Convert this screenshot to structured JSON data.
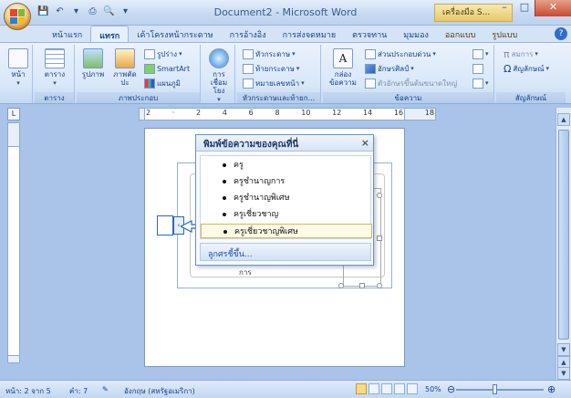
{
  "window": {
    "title": "Document2 - Microsoft Word",
    "context_tab": "เครื่องมือ S...",
    "minimize": "–",
    "maximize": "□",
    "close": "✕"
  },
  "quick_access": {
    "save": "💾",
    "undo": "↶",
    "separator": "▾",
    "print": "⎙",
    "preview": "🔍",
    "more": "▾"
  },
  "tabs": [
    {
      "label": "หน้าแรก",
      "active": false
    },
    {
      "label": "แทรก",
      "active": true
    },
    {
      "label": "เค้าโครงหน้ากระดาษ",
      "active": false
    },
    {
      "label": "การอ้างอิง",
      "active": false
    },
    {
      "label": "การส่งจดหมาย",
      "active": false
    },
    {
      "label": "ตรวจทาน",
      "active": false
    },
    {
      "label": "มุมมอง",
      "active": false
    },
    {
      "label": "ออกแบบ",
      "active": false
    },
    {
      "label": "รูปแบบ",
      "active": false
    }
  ],
  "help": "?",
  "ribbon": {
    "pages": {
      "button": "หน้า",
      "caret": "▾"
    },
    "tables": {
      "button": "ตาราง",
      "caret": "▾",
      "group": "ตาราง"
    },
    "illustrations": {
      "picture": "รูปภาพ",
      "clipart": "ภาพตัดปะ",
      "shapes": "รูปร่าง",
      "smartart": "SmartArt",
      "chart": "แผนภูมิ",
      "group": "ภาพประกอบ"
    },
    "links": {
      "button": "การเชื่อมโยง",
      "caret": "▾"
    },
    "header_footer": {
      "header": "หัวกระดาษ",
      "footer": "ท้ายกระดาษ",
      "page_number": "หมายเลขหน้า",
      "group": "หัวกระดาษและท้ายก..."
    },
    "text": {
      "textbox": "กล่องข้อความ",
      "quick_parts": "ส่วนประกอบด่วน",
      "wordart": "อักษรศิลป์",
      "dropcap": "ตัวอักษรขึ้นต้นขนาดใหญ่",
      "group": "ข้อความ"
    },
    "symbols": {
      "equation": "สมการ",
      "symbol": "สัญลักษณ์",
      "group": "สัญลักษณ์",
      "pi": "π",
      "omega": "Ω"
    }
  },
  "ruler": {
    "corner": "L",
    "numbers": [
      "2",
      "·",
      "2",
      "4",
      "6",
      "8",
      "10",
      "12",
      "14",
      "16",
      "18"
    ]
  },
  "text_pane": {
    "title": "พิมพ์ข้อความของคุณที่นี่",
    "close": "×",
    "items": [
      "ครู",
      "ครูชำนาญการ",
      "ครูชำนาญพิเศษ",
      "ครูเชี่ยวชาญ",
      "ครูเชี่ยวชาญพิเศษ"
    ],
    "selected_index": 4,
    "footer": "ลูกศรชี้ขึ้น..."
  },
  "smartart": {
    "label": "การ",
    "grip": "‹"
  },
  "statusbar": {
    "page": "หน้า: 2 จาก 5",
    "words": "คำ: 7",
    "language": "อังกฤษ (สหรัฐอเมริกา)",
    "zoom": "50%",
    "zoom_out": "⊖",
    "zoom_in": "⊕"
  },
  "scrollbar": {
    "up": "▲",
    "down": "▼",
    "prev": "▲",
    "next": "▼"
  },
  "colors": {
    "ribbon": "#d9e7f9",
    "accent": "#15428b",
    "selected": "#d9b84a"
  }
}
